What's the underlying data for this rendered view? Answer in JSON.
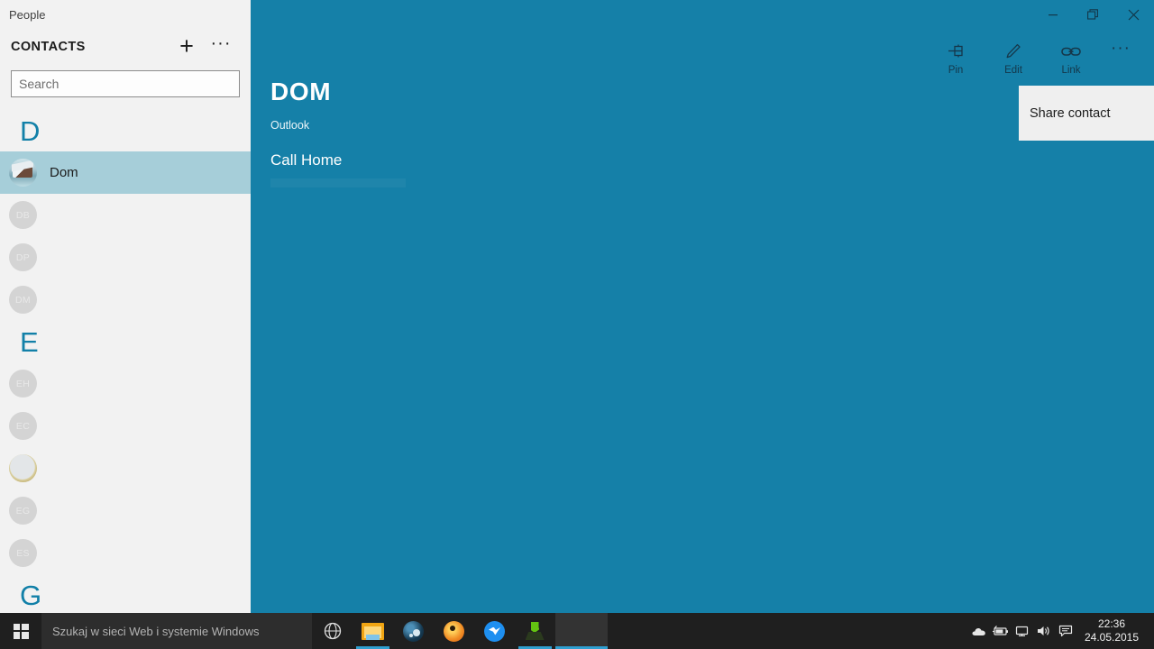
{
  "window": {
    "app_title": "People",
    "controls": [
      {
        "name": "minimize",
        "glyph": "minimize-icon"
      },
      {
        "name": "restore",
        "glyph": "restore-icon"
      },
      {
        "name": "close",
        "glyph": "close-icon"
      }
    ]
  },
  "colors": {
    "accent": "#1580a8",
    "sidebar_bg": "#f2f2f2",
    "selection": "#a6ced9",
    "section_letter": "#1280a8",
    "flyout_bg": "#efefef",
    "taskbar_bg": "#1f1f1f",
    "taskbar_search_bg": "#2d2d2d",
    "taskbar_indicator": "#2f9fd0"
  },
  "sidebar": {
    "header_label": "CONTACTS",
    "add_button_label": "+",
    "more_button_label": "···",
    "search": {
      "placeholder": "Search",
      "value": ""
    },
    "sections": [
      {
        "letter": "D",
        "contacts": [
          {
            "initials": "",
            "name": "Dom",
            "selected": true,
            "avatar": "photo-house"
          },
          {
            "initials": "DB",
            "name": "",
            "selected": false,
            "avatar": "initials"
          },
          {
            "initials": "DP",
            "name": "",
            "selected": false,
            "avatar": "initials"
          },
          {
            "initials": "DM",
            "name": "",
            "selected": false,
            "avatar": "initials"
          }
        ]
      },
      {
        "letter": "E",
        "contacts": [
          {
            "initials": "EH",
            "name": "",
            "selected": false,
            "avatar": "initials"
          },
          {
            "initials": "EC",
            "name": "",
            "selected": false,
            "avatar": "initials"
          },
          {
            "initials": "",
            "name": "",
            "selected": false,
            "avatar": "photo-ring"
          },
          {
            "initials": "EG",
            "name": "",
            "selected": false,
            "avatar": "initials"
          },
          {
            "initials": "ES",
            "name": "",
            "selected": false,
            "avatar": "initials"
          }
        ]
      },
      {
        "letter": "G",
        "contacts": []
      }
    ]
  },
  "detail": {
    "command_bar": [
      {
        "label": "Pin",
        "icon": "pin-icon"
      },
      {
        "label": "Edit",
        "icon": "pencil-icon"
      },
      {
        "label": "Link",
        "icon": "link-icon"
      }
    ],
    "overflow_label": "···",
    "flyout": {
      "items": [
        {
          "label": "Share contact"
        }
      ]
    },
    "contact": {
      "name": "DOM",
      "source": "Outlook",
      "note": "Call Home"
    }
  },
  "taskbar": {
    "start_label": "Start",
    "search_placeholder": "Szukaj w sieci Web i systemie Windows",
    "buttons": [
      {
        "name": "task-view",
        "running": false,
        "active": false
      },
      {
        "name": "file-explorer",
        "running": true,
        "active": false
      },
      {
        "name": "steam",
        "running": false,
        "active": false
      },
      {
        "name": "firefox",
        "running": false,
        "active": false
      },
      {
        "name": "messenger",
        "running": false,
        "active": false
      },
      {
        "name": "utorrent",
        "running": true,
        "active": false
      },
      {
        "name": "people-window",
        "running": false,
        "active": true
      }
    ],
    "tray": [
      {
        "name": "onedrive-icon"
      },
      {
        "name": "battery-icon"
      },
      {
        "name": "network-icon"
      },
      {
        "name": "volume-icon"
      },
      {
        "name": "action-center-icon"
      }
    ],
    "clock": {
      "time": "22:36",
      "date": "24.05.2015"
    }
  }
}
